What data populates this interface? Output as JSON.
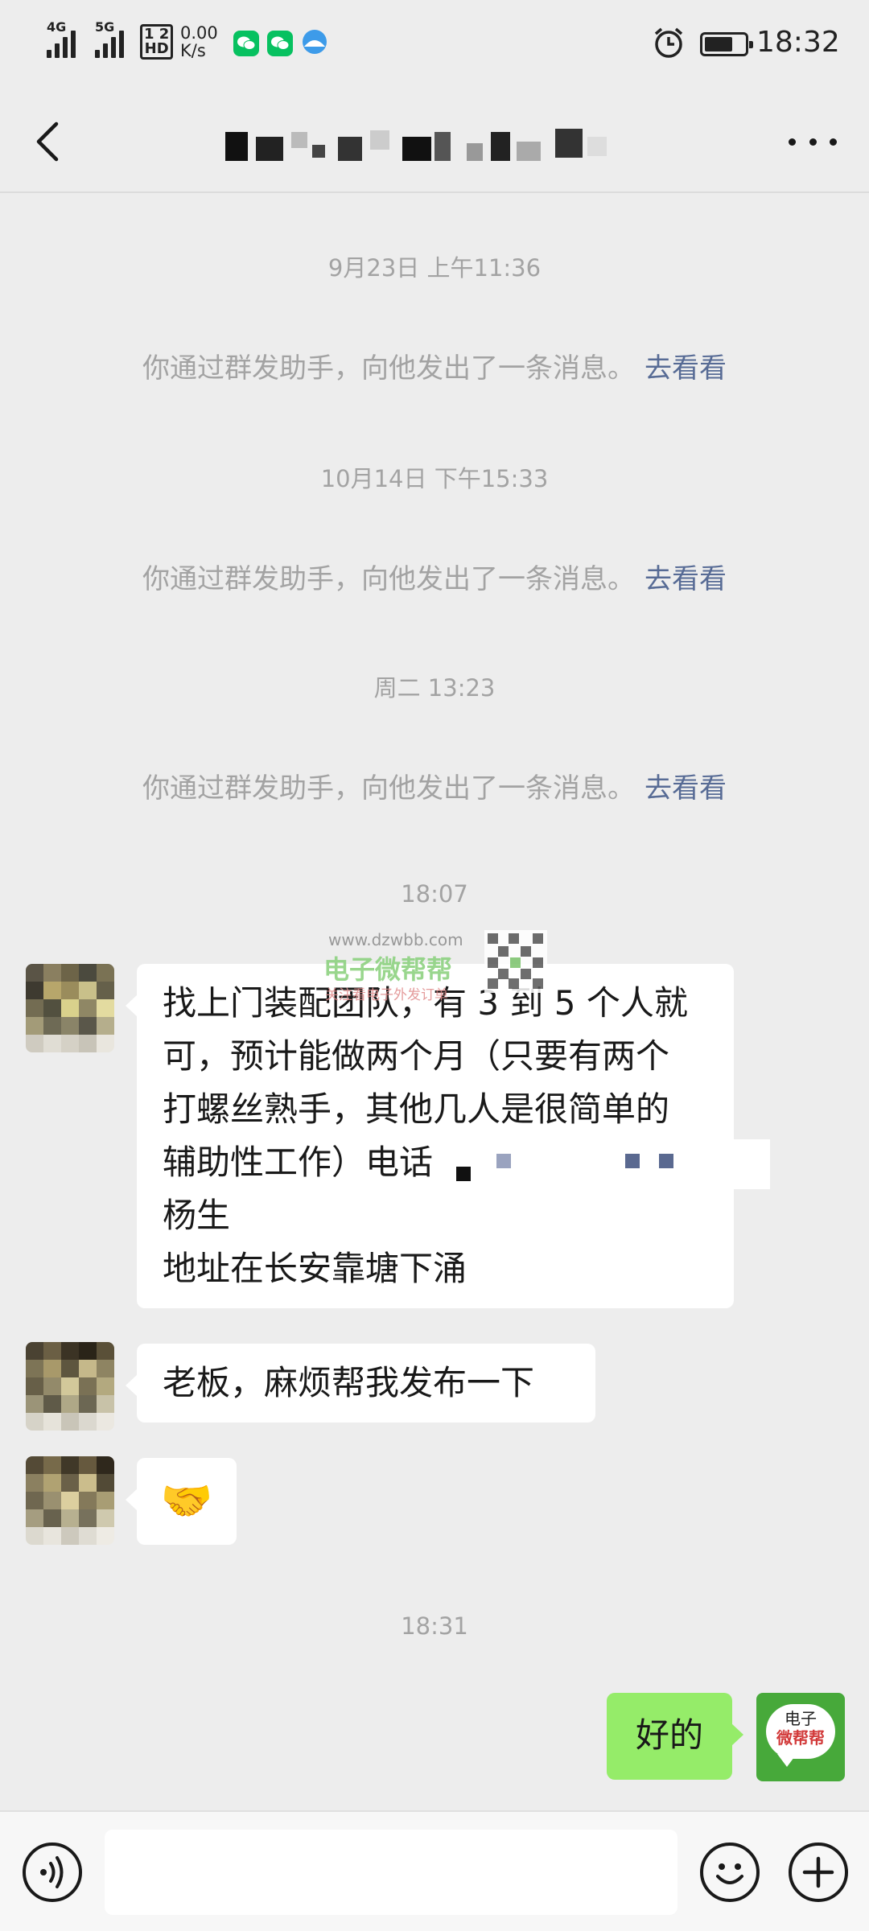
{
  "status_bar": {
    "signal1_label": "4G",
    "signal2_label": "5G",
    "hd_top": "1 2",
    "hd_bottom": "HD",
    "net_speed_value": "0.00",
    "net_speed_unit": "K/s",
    "time": "18:32",
    "battery_level": 0.7,
    "icons": [
      "signal-icon",
      "wechat-icon",
      "wechat-icon",
      "cloud-icon",
      "alarm-icon",
      "battery-icon"
    ]
  },
  "header": {
    "title": "",
    "back_icon": "chevron-left-icon",
    "more_icon": "more-dots-icon"
  },
  "messages": {
    "ts1": "9月23日 上午11:36",
    "sys1_text": "你通过群发助手，向他发出了一条消息。",
    "sys1_link": "去看看",
    "ts2": "10月14日 下午15:33",
    "sys2_text": "你通过群发助手，向他发出了一条消息。",
    "sys2_link": "去看看",
    "ts3": "周二 13:23",
    "sys3_text": "你通过群发助手，向他发出了一条消息。",
    "sys3_link": "去看看",
    "ts4": "18:07",
    "msg1_lines": [
      "找上门装配团队，有 3 到 5 个人就",
      "可，预计能做两个月（只要有两个",
      "打螺丝熟手，其他几人是很简单的",
      "辅助性工作）电话",
      "杨生",
      "地址在长安靠塘下涌"
    ],
    "msg2": "老板，麻烦帮我发布一下",
    "msg3_emoji": "🤝",
    "ts5": "18:31",
    "msg4": "好的",
    "my_avatar_text_1": "电子",
    "my_avatar_text_2": "微帮帮"
  },
  "watermark": {
    "url": "www.dzwbb.com",
    "name": "电子微帮帮",
    "sub": "关注看电子外发订单"
  },
  "input_bar": {
    "voice_icon": "voice-icon",
    "placeholder": "",
    "emoji_icon": "emoji-icon",
    "plus_icon": "plus-icon"
  },
  "colors": {
    "background": "#ededed",
    "bubble_other": "#ffffff",
    "bubble_mine": "#95ec69",
    "link": "#576b95",
    "meta_text": "#a3a3a3"
  }
}
